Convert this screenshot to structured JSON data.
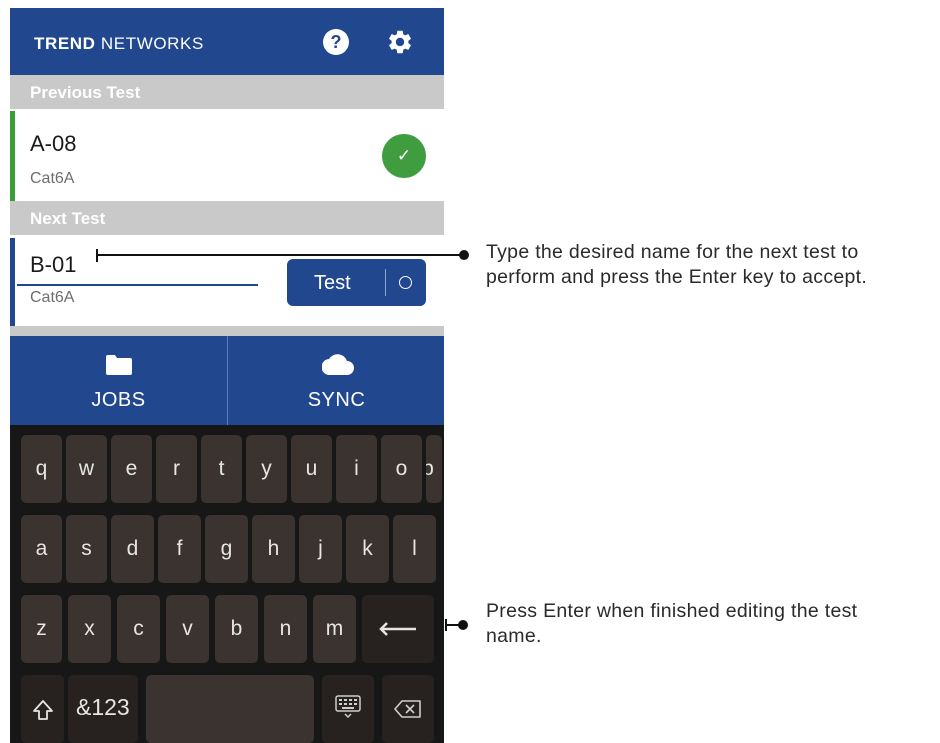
{
  "app": {
    "brand_bold": "TREND",
    "brand_light": "NETWORKS",
    "help_icon_label": "?",
    "icons": [
      "help-icon",
      "gear-icon",
      "check-icon",
      "folder-icon",
      "cloud-icon",
      "shift-icon",
      "enter-icon",
      "keyboard-icon",
      "backspace-icon"
    ]
  },
  "previous": {
    "header": "Previous Test",
    "name": "A-08",
    "type": "Cat6A",
    "status_glyph": "✓"
  },
  "next": {
    "header": "Next Test",
    "name_value": "B-01",
    "type": "Cat6A",
    "test_button": "Test"
  },
  "nav": {
    "jobs": "JOBS",
    "sync": "SYNC"
  },
  "keyboard": {
    "row1": [
      "q",
      "w",
      "e",
      "r",
      "t",
      "y",
      "u",
      "i",
      "o",
      "p"
    ],
    "row2": [
      "a",
      "s",
      "d",
      "f",
      "g",
      "h",
      "j",
      "k",
      "l"
    ],
    "row3": [
      "z",
      "x",
      "c",
      "v",
      "b",
      "n",
      "m"
    ],
    "symbols_key": "&123"
  },
  "callouts": {
    "name_line1": "Type the desired name for the next test to",
    "name_line2": "perform and press the Enter key to accept.",
    "enter_line1": "Press Enter when finished editing the test",
    "enter_line2": "name."
  },
  "colors": {
    "primary": "#21478f",
    "success": "#3f9c3f",
    "section_header": "#c9c9c9",
    "keyboard_bg": "#171717"
  }
}
